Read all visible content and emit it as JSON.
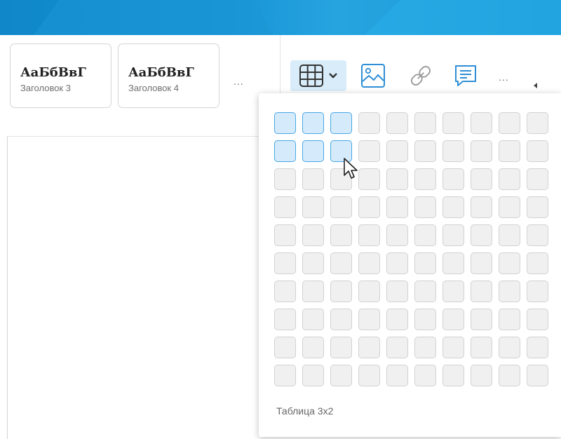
{
  "ribbon": {
    "styles": [
      {
        "sample": "АаБбВвГ",
        "name": "Заголовок 3"
      },
      {
        "sample": "АаБбВвГ",
        "name": "Заголовок 4"
      }
    ],
    "more_styles": "...",
    "more_tools": "...",
    "tools": [
      "table-icon",
      "chevron-down-icon",
      "image-icon",
      "link-icon",
      "comment-icon"
    ]
  },
  "table_picker": {
    "rows": 10,
    "cols": 10,
    "selected_cols": 3,
    "selected_rows": 2,
    "status": "Таблица 3x2"
  },
  "colors": {
    "accent": "#47a7e6",
    "selected_fill": "#d5ebfb",
    "cell_fill": "#f0f0f0",
    "header": "#1793d4"
  }
}
